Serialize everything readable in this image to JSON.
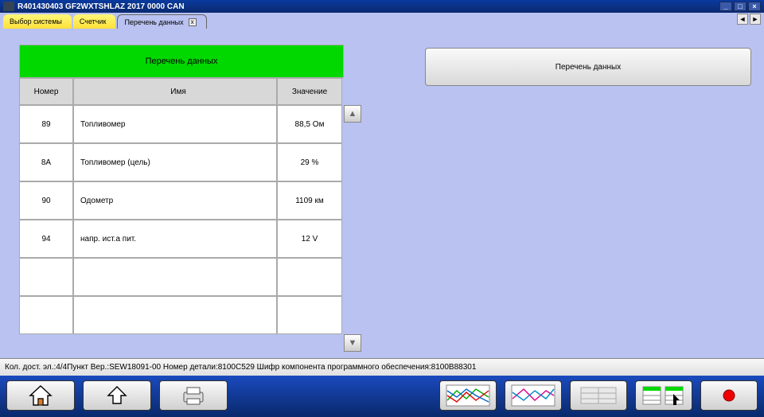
{
  "title": "R401430403   GF2WXTSHLAZ 2017    0000 CAN",
  "tabs": [
    {
      "label": "Выбор системы",
      "active": false,
      "style": "yellow"
    },
    {
      "label": "Счетчик",
      "active": false,
      "style": "yellow"
    },
    {
      "label": "Перечень данных",
      "active": true,
      "style": "active"
    }
  ],
  "table": {
    "title": "Перечень данных",
    "headers": {
      "num": "Номер",
      "name": "Имя",
      "val": "Значение"
    },
    "rows": [
      {
        "num": "89",
        "name": "Топливомер",
        "val": "88,5 Ом"
      },
      {
        "num": "8A",
        "name": "Топливомер (цель)",
        "val": "29 %"
      },
      {
        "num": "90",
        "name": "Одометр",
        "val": "1109 км"
      },
      {
        "num": "94",
        "name": "напр. ист.а пит.",
        "val": "12 V"
      },
      {
        "num": "",
        "name": "",
        "val": ""
      },
      {
        "num": "",
        "name": "",
        "val": ""
      }
    ]
  },
  "right_button": "Перечень данных",
  "status": "Кол. дост. эл.:4/4Пункт    Вер.:SEW18091-00 Номер детали:8100C529    Шифр компонента программного обеспечения:8100B88301"
}
